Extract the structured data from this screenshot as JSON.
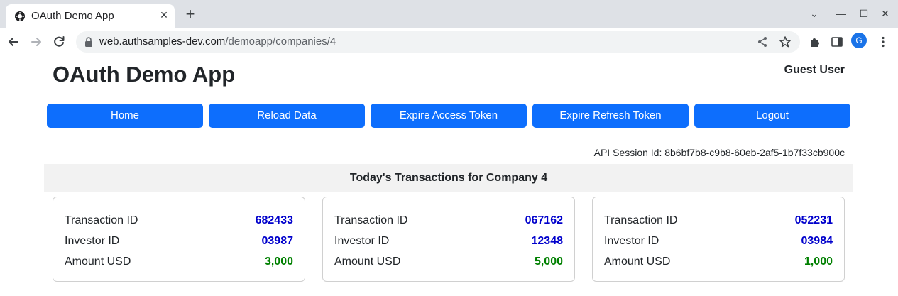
{
  "browser": {
    "tab_title": "OAuth Demo App",
    "new_tab_symbol": "+",
    "close_symbol": "✕",
    "url_domain": "web.authsamples-dev.com",
    "url_path": "/demoapp/companies/4",
    "profile_initial": "G",
    "window_controls": {
      "chevron": "⌄",
      "minimize": "—",
      "maximize": "☐",
      "close": "✕"
    }
  },
  "header": {
    "app_title": "OAuth Demo App",
    "user_name": "Guest User"
  },
  "buttons": {
    "home": "Home",
    "reload": "Reload Data",
    "expire_access": "Expire Access Token",
    "expire_refresh": "Expire Refresh Token",
    "logout": "Logout"
  },
  "session": {
    "text": "API Session Id: 8b6bf7b8-c9b8-60eb-2af5-1b7f33cb900c"
  },
  "transactions": {
    "heading": "Today's Transactions for Company 4",
    "labels": {
      "transaction_id": "Transaction ID",
      "investor_id": "Investor ID",
      "amount_usd": "Amount USD"
    },
    "items": [
      {
        "transaction_id": "682433",
        "investor_id": "03987",
        "amount_usd": "3,000"
      },
      {
        "transaction_id": "067162",
        "investor_id": "12348",
        "amount_usd": "5,000"
      },
      {
        "transaction_id": "052231",
        "investor_id": "03984",
        "amount_usd": "1,000"
      }
    ]
  },
  "colors": {
    "button": "#0d6efd",
    "id_value": "#0000cc",
    "amount_value": "#008000"
  }
}
